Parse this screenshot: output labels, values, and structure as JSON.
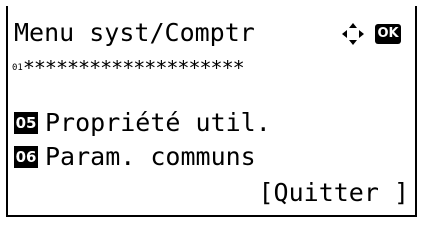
{
  "screen": {
    "title": "Menu syst/Comptr",
    "ok_label": "OK",
    "progress": {
      "index_text": "01",
      "stars": "********************"
    },
    "items": [
      {
        "number": "05",
        "label": "Propriété util."
      },
      {
        "number": "06",
        "label": "Param. communs"
      }
    ],
    "quit_label": "[Quitter ]"
  }
}
